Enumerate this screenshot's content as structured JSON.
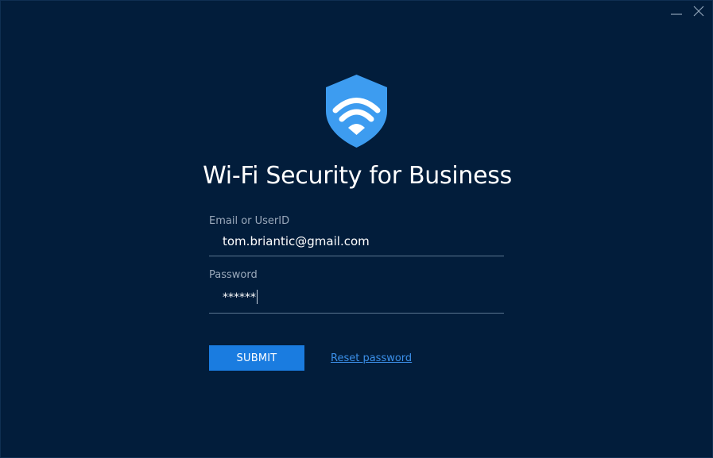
{
  "app": {
    "title": "Wi-Fi Security for Business",
    "logo_icon": "shield-wifi-icon",
    "window_controls": [
      "minimize-icon",
      "close-icon"
    ]
  },
  "form": {
    "email": {
      "label": "Email or UserID",
      "value": "tom.briantic@gmail.com"
    },
    "password": {
      "label": "Password",
      "value": "******"
    },
    "submit_label": "SUBMIT",
    "reset_link": "Reset password"
  },
  "colors": {
    "background": "#021d3b",
    "accent": "#1a7ce0",
    "link": "#3b8fe8",
    "shield": "#3d9cf0"
  }
}
